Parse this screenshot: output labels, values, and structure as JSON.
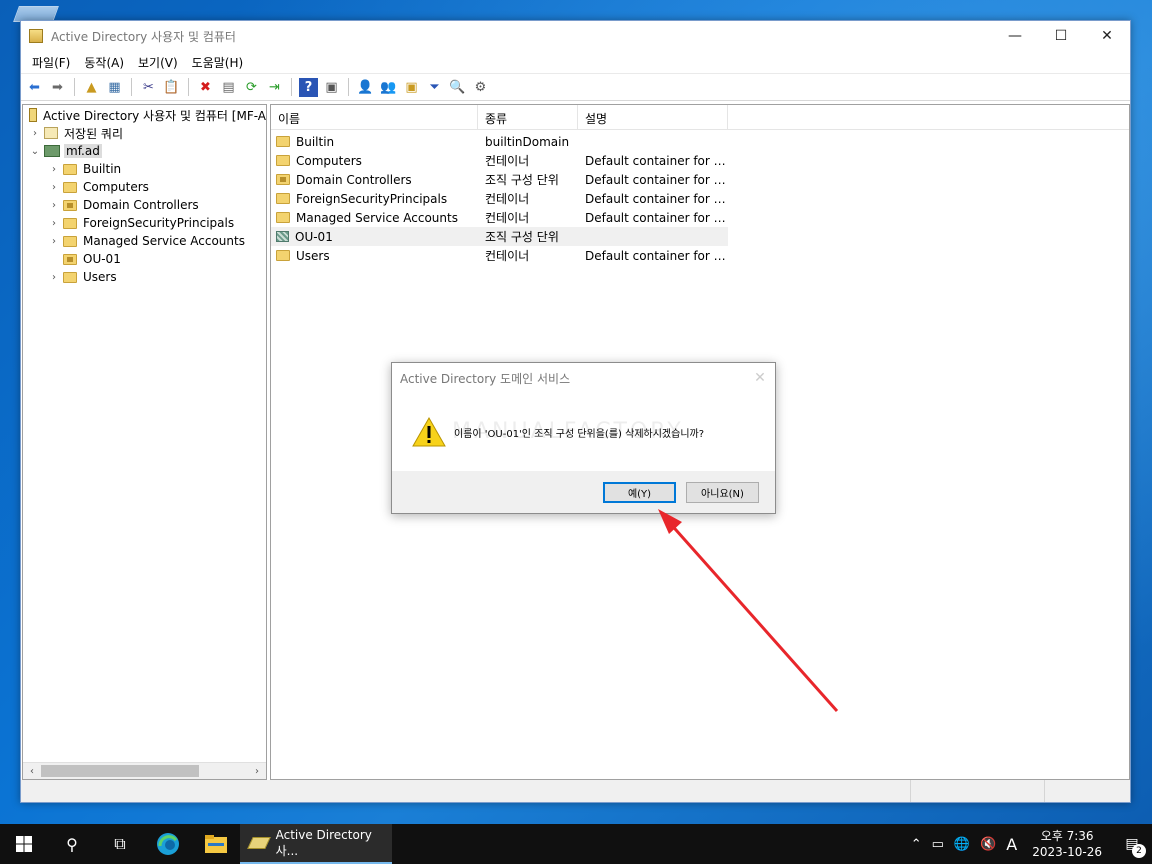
{
  "window": {
    "title": "Active Directory 사용자 및 컴퓨터",
    "controls": {
      "minimize": "—",
      "maximize": "☐",
      "close": "✕"
    }
  },
  "menu": [
    "파일(F)",
    "동작(A)",
    "보기(V)",
    "도움말(H)"
  ],
  "toolbar": {
    "icons": [
      "back-icon",
      "forward-icon",
      "up-folder-icon",
      "show-tree-icon",
      "cut-icon",
      "paste-icon",
      "delete-icon",
      "properties-icon",
      "refresh-icon",
      "export-icon",
      "help-icon",
      "console-icon",
      "new-user-icon",
      "new-group-icon",
      "new-ou-icon",
      "filter-icon",
      "find-icon",
      "add-to-group-icon"
    ]
  },
  "tree": {
    "root": "Active Directory 사용자 및 컴퓨터 [MF-A",
    "saved_queries": "저장된 쿼리",
    "domain": "mf.ad",
    "children": [
      {
        "label": "Builtin",
        "expandable": true,
        "kind": "folder"
      },
      {
        "label": "Computers",
        "expandable": true,
        "kind": "folder"
      },
      {
        "label": "Domain Controllers",
        "expandable": true,
        "kind": "ou"
      },
      {
        "label": "ForeignSecurityPrincipals",
        "expandable": true,
        "kind": "folder"
      },
      {
        "label": "Managed Service Accounts",
        "expandable": true,
        "kind": "folder"
      },
      {
        "label": "OU-01",
        "expandable": false,
        "kind": "ou"
      },
      {
        "label": "Users",
        "expandable": true,
        "kind": "folder"
      }
    ]
  },
  "list": {
    "columns": [
      "이름",
      "종류",
      "설명"
    ],
    "rows": [
      {
        "name": "Builtin",
        "type": "builtinDomain",
        "desc": "",
        "icon": "folder"
      },
      {
        "name": "Computers",
        "type": "컨테이너",
        "desc": "Default container for u...",
        "icon": "folder"
      },
      {
        "name": "Domain Controllers",
        "type": "조직 구성 단위",
        "desc": "Default container for d...",
        "icon": "ou"
      },
      {
        "name": "ForeignSecurityPrincipals",
        "type": "컨테이너",
        "desc": "Default container for se...",
        "icon": "folder"
      },
      {
        "name": "Managed Service Accounts",
        "type": "컨테이너",
        "desc": "Default container for m...",
        "icon": "folder"
      },
      {
        "name": "OU-01",
        "type": "조직 구성 단위",
        "desc": "",
        "icon": "ou-selected"
      },
      {
        "name": "Users",
        "type": "컨테이너",
        "desc": "Default container for u...",
        "icon": "folder"
      }
    ]
  },
  "dialog": {
    "title": "Active Directory 도메인 서비스",
    "message": "이름이 'OU-01'인 조직 구성 단위을(를) 삭제하시겠습니까?",
    "watermark": "MANUALFACTORY",
    "yes": "예(Y)",
    "no": "아니요(N)"
  },
  "taskbar": {
    "app_label": "Active Directory 사...",
    "time": "오후 7:36",
    "date": "2023-10-26",
    "ime": "A",
    "notifications": "2"
  }
}
